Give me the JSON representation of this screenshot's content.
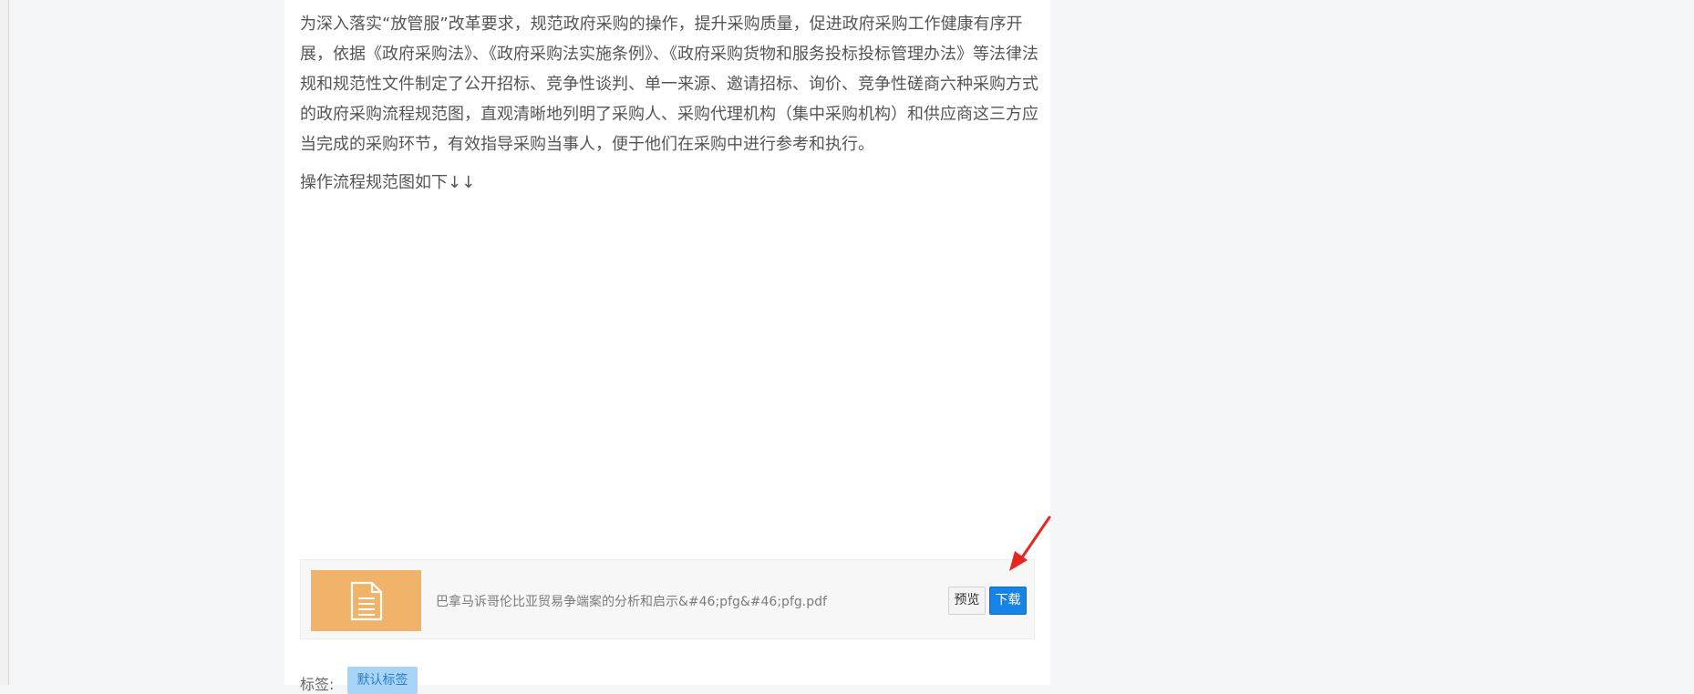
{
  "article": {
    "intro_text": "为深入落实“放管服”改革要求，规范政府采购的操作，提升采购质量，促进政府采购工作健康有序开展，依据《政府采购法》、《政府采购法实施条例》、《政府采购货物和服务投标投标管理办法》等法律法规和规范性文件制定了公开招标、竞争性谈判、单一来源、邀请招标、询价、竞争性磋商六种采购方式的政府采购流程规范图，直观清晰地列明了采购人、采购代理机构（集中采购机构）和供应商这三方应当完成的采购环节，有效指导采购当事人，便于他们在采购中进行参考和执行。",
    "followup_text": "操作流程规范图如下↓↓"
  },
  "attachment": {
    "icon": "document-icon",
    "thumb_color": "#f1b26a",
    "file_name": "巴拿马诉哥伦比亚贸易争端案的分析和启示&#46;pfg&#46;pfg.pdf",
    "preview_label": "预览",
    "download_label": "下载",
    "download_color": "#1683e6"
  },
  "tags": {
    "label": "标签:",
    "items": [
      "默认标签"
    ]
  },
  "annotation": {
    "arrow_color": "#e8261f"
  }
}
